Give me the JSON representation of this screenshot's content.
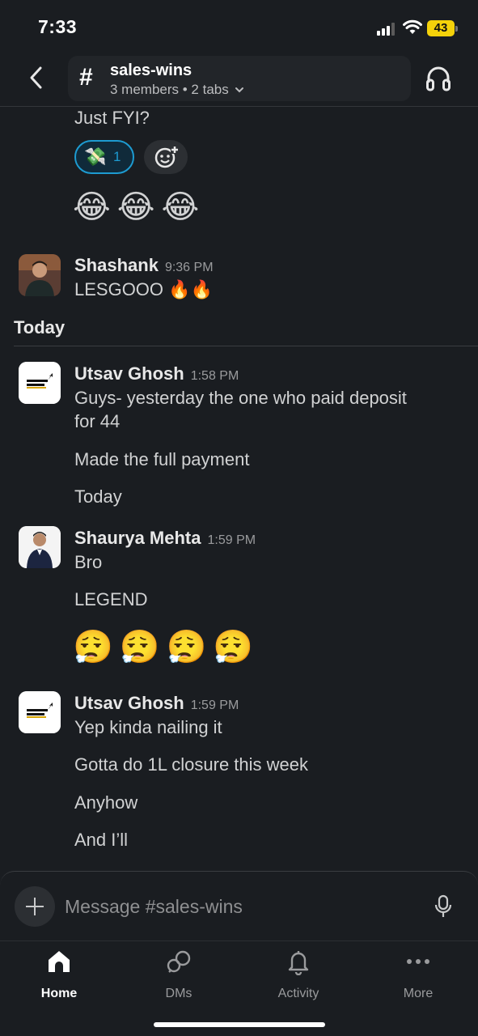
{
  "status_bar": {
    "time": "7:33",
    "battery": "43"
  },
  "header": {
    "channel_name": "sales-wins",
    "channel_meta": "3 members • 2 tabs",
    "hash": "#"
  },
  "messages": {
    "top_text": "Just FYI?",
    "reaction": {
      "emoji": "💸",
      "count": "1"
    },
    "laugh_emojis": "😂😂😂",
    "shashank": {
      "name": "Shashank",
      "time": "9:36 PM",
      "text": "LESGOOO 🔥🔥"
    },
    "divider": "Today",
    "utsav1": {
      "name": "Utsav Ghosh",
      "time": "1:58 PM",
      "line1": "Guys- yesterday the one who paid deposit",
      "line2": "for 44",
      "line3": "Made the full payment",
      "line4": "Today"
    },
    "shaurya": {
      "name": "Shaurya Mehta",
      "time": "1:59 PM",
      "line1": "Bro",
      "line2": "LEGEND",
      "emojis": "😮‍💨😮‍💨😮‍💨😮‍💨"
    },
    "utsav2": {
      "name": "Utsav Ghosh",
      "time": "1:59 PM",
      "line1": "Yep kinda nailing it",
      "line2": "Gotta do 1L closure this week",
      "line3": "Anyhow",
      "line4": "And I’ll"
    }
  },
  "composer": {
    "placeholder": "Message #sales-wins"
  },
  "tabs": [
    {
      "label": "Home"
    },
    {
      "label": "DMs"
    },
    {
      "label": "Activity"
    },
    {
      "label": "More"
    }
  ],
  "colors": {
    "background": "#1a1d21",
    "accent": "#1d9bd1",
    "battery": "#f5d20a"
  }
}
